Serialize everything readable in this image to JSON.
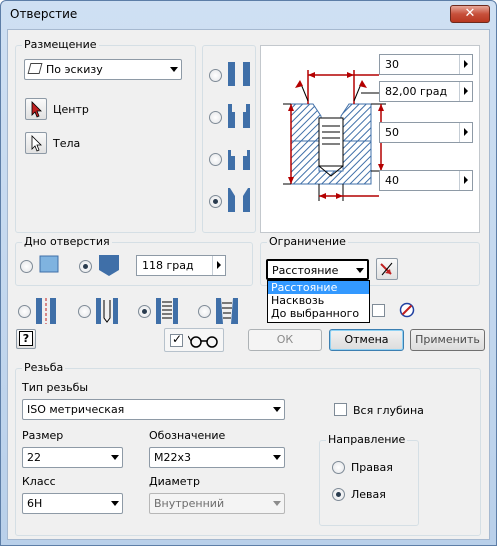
{
  "window": {
    "title": "Отверстие",
    "close_glyph": "✕"
  },
  "placement": {
    "label": "Размещение",
    "type_value": "По эскизу",
    "center_label": "Центр",
    "solids_label": "Тела"
  },
  "dimensions": {
    "d1": "30",
    "d2": "82,00 град",
    "d3": "50",
    "d4": "40"
  },
  "bottom": {
    "label": "Дно отверстия",
    "angle_value": "118 град"
  },
  "termination": {
    "label": "Ограничение",
    "value": "Расстояние",
    "options": [
      "Расстояние",
      "Насквозь",
      "До выбранного"
    ],
    "selected_index": 0
  },
  "buttons": {
    "ok": "ОК",
    "cancel": "Отмена",
    "apply": "Применить",
    "help": "?"
  },
  "thread": {
    "label": "Резьба",
    "type_label": "Тип резьбы",
    "type_value": "ISO метрическая",
    "full_depth_label": "Вся глубина",
    "size_label": "Размер",
    "size_value": "22",
    "designation_label": "Обозначение",
    "designation_value": "M22x3",
    "class_label": "Класс",
    "class_value": "6H",
    "diameter_label": "Диаметр",
    "diameter_value": "Внутренний",
    "direction": {
      "label": "Направление",
      "right": "Правая",
      "left": "Левая",
      "selected": "left"
    }
  },
  "colors": {
    "accent_red": "#b40000",
    "selection_blue": "#3399ff",
    "hatch_blue": "#3f6fa8"
  }
}
